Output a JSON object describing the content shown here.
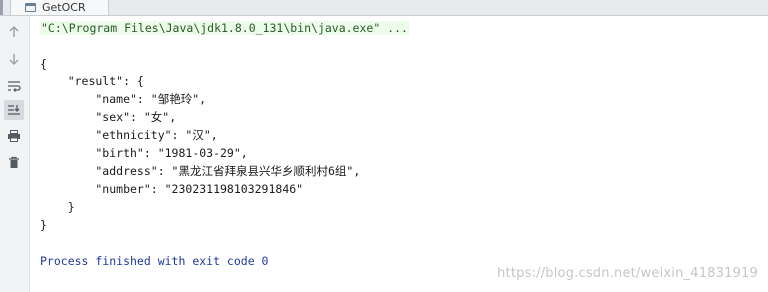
{
  "tab": {
    "title": "GetOCR",
    "icon": "console-window-icon"
  },
  "toolbar": {
    "icons": [
      "arrow-up-icon",
      "arrow-down-icon",
      "soft-wrap-icon",
      "scroll-to-end-icon",
      "print-icon",
      "trash-icon"
    ]
  },
  "console": {
    "command": "\"C:\\Program Files\\Java\\jdk1.8.0_131\\bin\\java.exe\" ...",
    "lines": [
      "{",
      "    \"result\": {",
      "        \"name\": \"邹艳玲\",",
      "        \"sex\": \"女\",",
      "        \"ethnicity\": \"汉\",",
      "        \"birth\": \"1981-03-29\",",
      "        \"address\": \"黑龙江省拜泉县兴华乡顺利村6组\",",
      "        \"number\": \"230231198103291846\"",
      "    }",
      "}"
    ],
    "exit_message": "Process finished with exit code 0"
  },
  "watermark": "https://blog.csdn.net/weixin_41831919"
}
